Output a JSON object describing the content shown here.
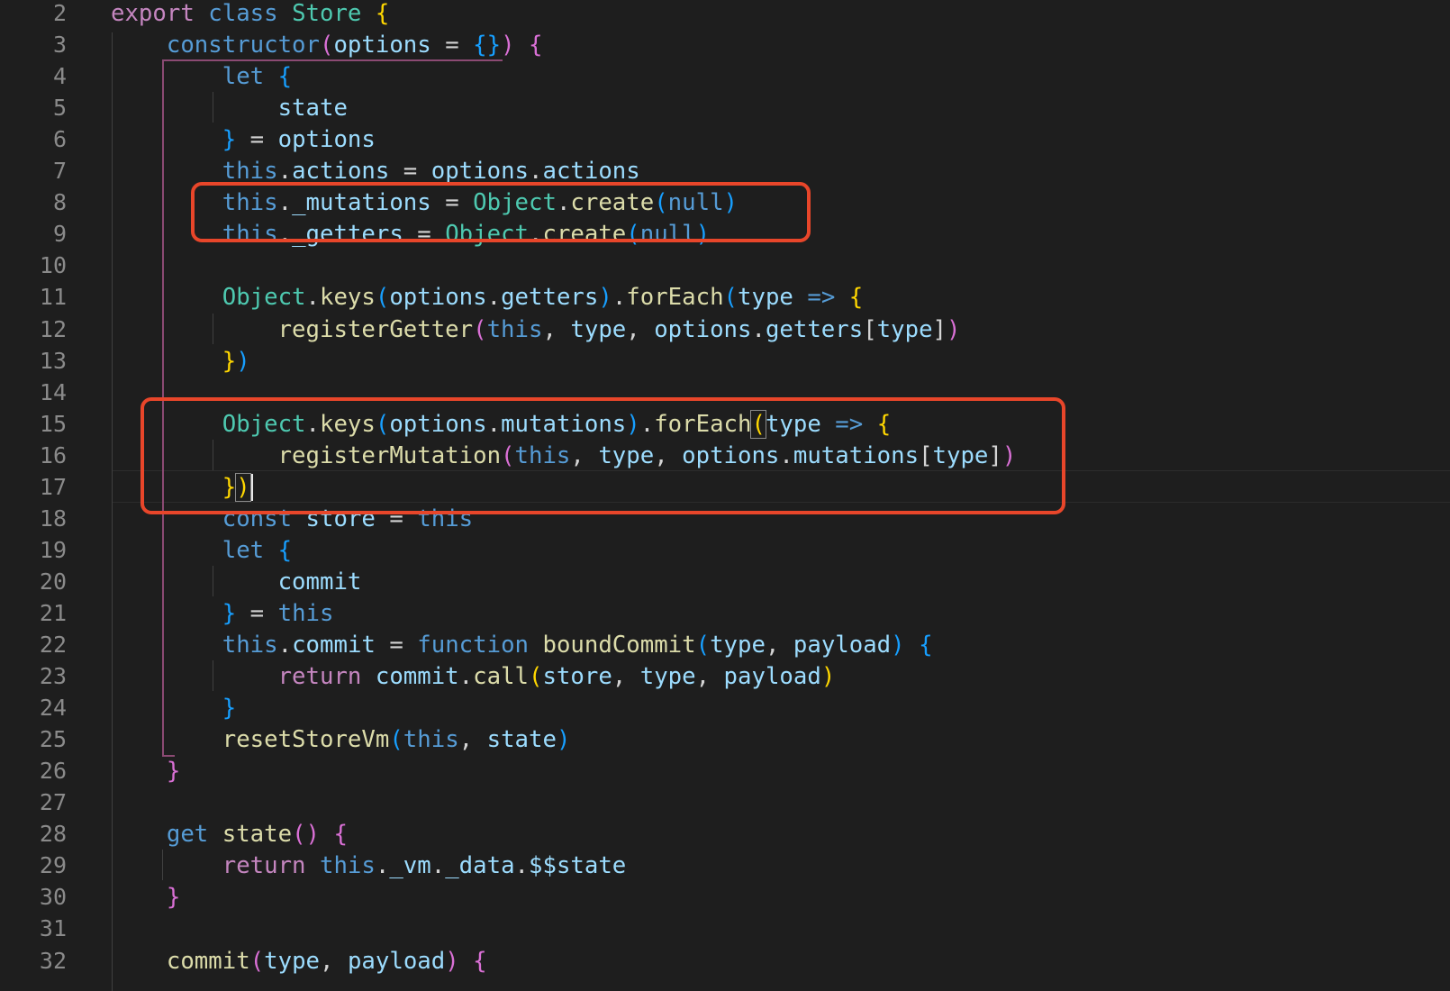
{
  "editor": {
    "first_line_number": 2,
    "colors": {
      "background": "#1e1e1e",
      "keyword_blue": "#569cd6",
      "keyword_purple": "#c586c0",
      "class_teal": "#4ec9b0",
      "function_yellow": "#dcdcaa",
      "variable": "#9cdcfe",
      "bracket_gold": "#ffd700",
      "bracket_pink": "#da70d6",
      "bracket_blue": "#179fff",
      "highlight_box": "#e8462a"
    },
    "highlight_box_labels": [
      "highlight-box-mutations-create",
      "highlight-box-register-mutations"
    ],
    "lines": [
      [
        [
          "export",
          "p"
        ],
        [
          " ",
          "t"
        ],
        [
          "class",
          "b"
        ],
        [
          " ",
          "t"
        ],
        [
          "Store",
          "c"
        ],
        [
          " ",
          "t"
        ],
        [
          "{",
          "g"
        ]
      ],
      [
        [
          "    ",
          "t"
        ],
        [
          "constructor",
          "b"
        ],
        [
          "(",
          "pk"
        ],
        [
          "options",
          "v"
        ],
        [
          " = ",
          "t"
        ],
        [
          "{}",
          "bl"
        ],
        [
          ")",
          "pk"
        ],
        [
          " ",
          "t"
        ],
        [
          "{",
          "pk"
        ]
      ],
      [
        [
          "        ",
          "t"
        ],
        [
          "let",
          "b"
        ],
        [
          " ",
          "t"
        ],
        [
          "{",
          "bl"
        ]
      ],
      [
        [
          "            ",
          "t"
        ],
        [
          "state",
          "v"
        ]
      ],
      [
        [
          "        ",
          "t"
        ],
        [
          "}",
          "bl"
        ],
        [
          " = ",
          "t"
        ],
        [
          "options",
          "v"
        ]
      ],
      [
        [
          "        ",
          "t"
        ],
        [
          "this",
          "b"
        ],
        [
          ".",
          "t"
        ],
        [
          "actions",
          "v"
        ],
        [
          " = ",
          "t"
        ],
        [
          "options",
          "v"
        ],
        [
          ".",
          "t"
        ],
        [
          "actions",
          "v"
        ]
      ],
      [
        [
          "        ",
          "t"
        ],
        [
          "this",
          "b"
        ],
        [
          ".",
          "t"
        ],
        [
          "_mutations",
          "v"
        ],
        [
          " = ",
          "t"
        ],
        [
          "Object",
          "c"
        ],
        [
          ".",
          "t"
        ],
        [
          "create",
          "f"
        ],
        [
          "(",
          "bl"
        ],
        [
          "null",
          "b"
        ],
        [
          ")",
          "bl"
        ]
      ],
      [
        [
          "        ",
          "t"
        ],
        [
          "this",
          "b"
        ],
        [
          ".",
          "t"
        ],
        [
          "_getters",
          "v"
        ],
        [
          " = ",
          "t"
        ],
        [
          "Object",
          "c"
        ],
        [
          ".",
          "t"
        ],
        [
          "create",
          "f"
        ],
        [
          "(",
          "bl"
        ],
        [
          "null",
          "b"
        ],
        [
          ")",
          "bl"
        ]
      ],
      [],
      [
        [
          "        ",
          "t"
        ],
        [
          "Object",
          "c"
        ],
        [
          ".",
          "t"
        ],
        [
          "keys",
          "f"
        ],
        [
          "(",
          "bl"
        ],
        [
          "options",
          "v"
        ],
        [
          ".",
          "t"
        ],
        [
          "getters",
          "v"
        ],
        [
          ")",
          "bl"
        ],
        [
          ".",
          "t"
        ],
        [
          "forEach",
          "f"
        ],
        [
          "(",
          "bl"
        ],
        [
          "type",
          "v"
        ],
        [
          " ",
          "t"
        ],
        [
          "=>",
          "b"
        ],
        [
          " ",
          "t"
        ],
        [
          "{",
          "g"
        ]
      ],
      [
        [
          "            ",
          "t"
        ],
        [
          "registerGetter",
          "f"
        ],
        [
          "(",
          "pk"
        ],
        [
          "this",
          "b"
        ],
        [
          ", ",
          "t"
        ],
        [
          "type",
          "v"
        ],
        [
          ", ",
          "t"
        ],
        [
          "options",
          "v"
        ],
        [
          ".",
          "t"
        ],
        [
          "getters",
          "v"
        ],
        [
          "[",
          "t"
        ],
        [
          "type",
          "v"
        ],
        [
          "]",
          "t"
        ],
        [
          ")",
          "pk"
        ]
      ],
      [
        [
          "        ",
          "t"
        ],
        [
          "}",
          "g"
        ],
        [
          ")",
          "bl"
        ]
      ],
      [],
      [
        [
          "        ",
          "t"
        ],
        [
          "Object",
          "c"
        ],
        [
          ".",
          "t"
        ],
        [
          "keys",
          "f"
        ],
        [
          "(",
          "bl"
        ],
        [
          "options",
          "v"
        ],
        [
          ".",
          "t"
        ],
        [
          "mutations",
          "v"
        ],
        [
          ")",
          "bl"
        ],
        [
          ".",
          "t"
        ],
        [
          "forEach",
          "f"
        ],
        [
          "(",
          "bx"
        ],
        [
          "type",
          "v"
        ],
        [
          " ",
          "t"
        ],
        [
          "=>",
          "b"
        ],
        [
          " ",
          "t"
        ],
        [
          "{",
          "g"
        ]
      ],
      [
        [
          "            ",
          "t"
        ],
        [
          "registerMutation",
          "f"
        ],
        [
          "(",
          "pk"
        ],
        [
          "this",
          "b"
        ],
        [
          ", ",
          "t"
        ],
        [
          "type",
          "v"
        ],
        [
          ", ",
          "t"
        ],
        [
          "options",
          "v"
        ],
        [
          ".",
          "t"
        ],
        [
          "mutations",
          "v"
        ],
        [
          "[",
          "t"
        ],
        [
          "type",
          "v"
        ],
        [
          "]",
          "t"
        ],
        [
          ")",
          "pk"
        ]
      ],
      [
        [
          "        ",
          "t"
        ],
        [
          "}",
          "g"
        ],
        [
          ")",
          "bx"
        ]
      ],
      [
        [
          "        ",
          "t"
        ],
        [
          "const",
          "b"
        ],
        [
          " ",
          "t"
        ],
        [
          "store",
          "v"
        ],
        [
          " = ",
          "t"
        ],
        [
          "this",
          "b"
        ]
      ],
      [
        [
          "        ",
          "t"
        ],
        [
          "let",
          "b"
        ],
        [
          " ",
          "t"
        ],
        [
          "{",
          "bl"
        ]
      ],
      [
        [
          "            ",
          "t"
        ],
        [
          "commit",
          "v"
        ]
      ],
      [
        [
          "        ",
          "t"
        ],
        [
          "}",
          "bl"
        ],
        [
          " = ",
          "t"
        ],
        [
          "this",
          "b"
        ]
      ],
      [
        [
          "        ",
          "t"
        ],
        [
          "this",
          "b"
        ],
        [
          ".",
          "t"
        ],
        [
          "commit",
          "v"
        ],
        [
          " = ",
          "t"
        ],
        [
          "function",
          "b"
        ],
        [
          " ",
          "t"
        ],
        [
          "boundCommit",
          "f"
        ],
        [
          "(",
          "bl"
        ],
        [
          "type",
          "v"
        ],
        [
          ", ",
          "t"
        ],
        [
          "payload",
          "v"
        ],
        [
          ")",
          "bl"
        ],
        [
          " ",
          "t"
        ],
        [
          "{",
          "bl"
        ]
      ],
      [
        [
          "            ",
          "t"
        ],
        [
          "return",
          "p"
        ],
        [
          " ",
          "t"
        ],
        [
          "commit",
          "v"
        ],
        [
          ".",
          "t"
        ],
        [
          "call",
          "f"
        ],
        [
          "(",
          "g"
        ],
        [
          "store",
          "v"
        ],
        [
          ", ",
          "t"
        ],
        [
          "type",
          "v"
        ],
        [
          ", ",
          "t"
        ],
        [
          "payload",
          "v"
        ],
        [
          ")",
          "g"
        ]
      ],
      [
        [
          "        ",
          "t"
        ],
        [
          "}",
          "bl"
        ]
      ],
      [
        [
          "        ",
          "t"
        ],
        [
          "resetStoreVm",
          "f"
        ],
        [
          "(",
          "bl"
        ],
        [
          "this",
          "b"
        ],
        [
          ", ",
          "t"
        ],
        [
          "state",
          "v"
        ],
        [
          ")",
          "bl"
        ]
      ],
      [
        [
          "    ",
          "t"
        ],
        [
          "}",
          "pk"
        ]
      ],
      [],
      [
        [
          "    ",
          "t"
        ],
        [
          "get",
          "b"
        ],
        [
          " ",
          "t"
        ],
        [
          "state",
          "f"
        ],
        [
          "()",
          "pk"
        ],
        [
          " ",
          "t"
        ],
        [
          "{",
          "pk"
        ]
      ],
      [
        [
          "        ",
          "t"
        ],
        [
          "return",
          "p"
        ],
        [
          " ",
          "t"
        ],
        [
          "this",
          "b"
        ],
        [
          ".",
          "t"
        ],
        [
          "_vm",
          "v"
        ],
        [
          ".",
          "t"
        ],
        [
          "_data",
          "v"
        ],
        [
          ".",
          "t"
        ],
        [
          "$$state",
          "v"
        ]
      ],
      [
        [
          "    ",
          "t"
        ],
        [
          "}",
          "pk"
        ]
      ],
      [],
      [
        [
          "    ",
          "t"
        ],
        [
          "commit",
          "f"
        ],
        [
          "(",
          "pk"
        ],
        [
          "type",
          "v"
        ],
        [
          ", ",
          "t"
        ],
        [
          "payload",
          "v"
        ],
        [
          ")",
          "pk"
        ],
        [
          " ",
          "t"
        ],
        [
          "{",
          "pk"
        ]
      ]
    ]
  }
}
